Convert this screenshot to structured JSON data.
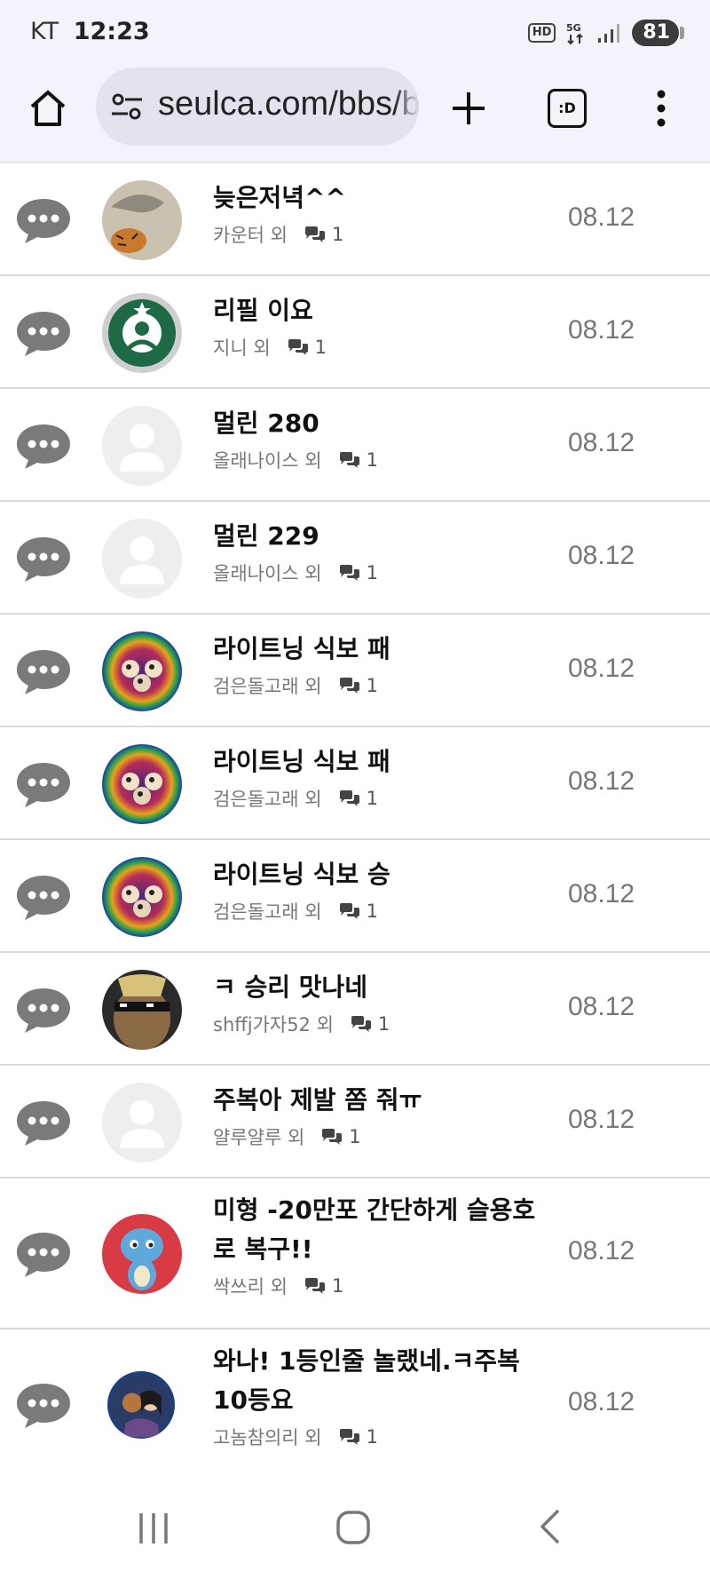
{
  "status_bar": {
    "carrier": "KT",
    "time": "12:23",
    "hd": "HD",
    "network": "5G",
    "battery": "81"
  },
  "browser": {
    "url": "seulca.com/bbs/board.php",
    "tabs_label": ":D"
  },
  "posts": [
    {
      "title": "늦은저녁^^",
      "author": "카운터 외",
      "comments": "1",
      "date": "08.12",
      "avatar": "dragon-tiger-painting",
      "avatar_color": "#c9c2b0"
    },
    {
      "title": "리필 이요",
      "author": "지니 외",
      "comments": "1",
      "date": "08.12",
      "avatar": "starbucks-logo",
      "avatar_color": "#1e6a46"
    },
    {
      "title": "멀린 280",
      "author": "올래나이스 외",
      "comments": "1",
      "date": "08.12",
      "avatar": "default-user",
      "avatar_color": "#eeeeee"
    },
    {
      "title": "멀린 229",
      "author": "올래나이스 외",
      "comments": "1",
      "date": "08.12",
      "avatar": "default-user",
      "avatar_color": "#eeeeee"
    },
    {
      "title": "라이트닝 식보 패",
      "author": "검은돌고래 외",
      "comments": "1",
      "date": "08.12",
      "avatar": "rainbow-owls",
      "avatar_color": "#4a2a7a"
    },
    {
      "title": "라이트닝 식보 패",
      "author": "검은돌고래 외",
      "comments": "1",
      "date": "08.12",
      "avatar": "rainbow-owls",
      "avatar_color": "#4a2a7a"
    },
    {
      "title": "라이트닝 식보 승",
      "author": "검은돌고래 외",
      "comments": "1",
      "date": "08.12",
      "avatar": "rainbow-owls",
      "avatar_color": "#4a2a7a"
    },
    {
      "title": "ㅋ 승리 맛나네",
      "author": "shffj가자52 외",
      "comments": "1",
      "date": "08.12",
      "avatar": "cat-with-sunglasses",
      "avatar_color": "#8a6a44"
    },
    {
      "title": "주복아 제발 쫌 줘ㅠ",
      "author": "얄루얄루 외",
      "comments": "1",
      "date": "08.12",
      "avatar": "default-user",
      "avatar_color": "#eeeeee"
    },
    {
      "title": "미형 -20만포 간단하게 슬용호로 복구!!",
      "author": "싹쓰리 외",
      "comments": "1",
      "date": "08.12",
      "avatar": "blue-dragon-cartoon",
      "avatar_color": "#d93b44"
    },
    {
      "title": "와나! 1등인줄 놀랬네.ㅋ주복 10등요",
      "author": "고놈참의리 외",
      "comments": "1",
      "date": "08.12",
      "avatar": "two-people-photo",
      "avatar_color": "#1f3f7a"
    }
  ]
}
